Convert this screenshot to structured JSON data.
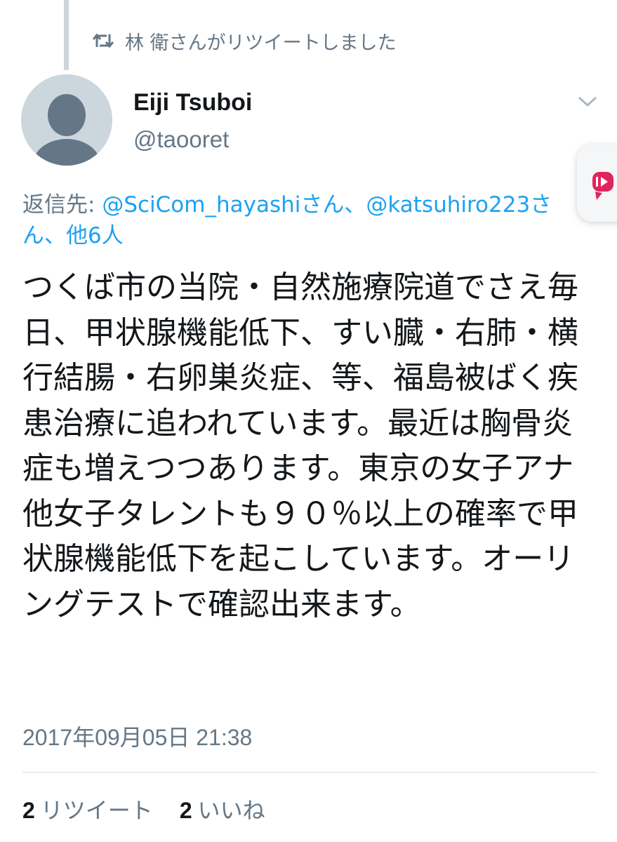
{
  "retweet_context": {
    "icon": "retweet-icon",
    "text": "林 衛さんがリツイートしました"
  },
  "author": {
    "avatar_icon": "default-avatar-icon",
    "name": "Eiji Tsuboi",
    "handle": "@taooret"
  },
  "reply_to": {
    "prefix": "返信先: ",
    "mention_1": "@SciCom_hayashiさん、",
    "mention_2": "@katsuhiro223さん、",
    "others": "他6人"
  },
  "tweet": {
    "text": "つくば市の当院・自然施療院道でさえ毎日、甲状腺機能低下、すい臓・右肺・横行結腸・右卵巣炎症、等、福島被ばく疾患治療に追われています。最近は胸骨炎症も増えつつあります。東京の女子アナ他女子タレントも９０％以上の確率で甲状腺機能低下を起こしています。オーリングテストで確認出来ます。",
    "timestamp": "2017年09月05日 21:38"
  },
  "stats": {
    "retweets_count": "2",
    "retweets_label": "リツイート",
    "likes_count": "2",
    "likes_label": "いいね"
  },
  "colors": {
    "link": "#1da1f2",
    "secondary_text": "#657786",
    "primary_text": "#14171a",
    "accent_red": "#e0245e"
  }
}
